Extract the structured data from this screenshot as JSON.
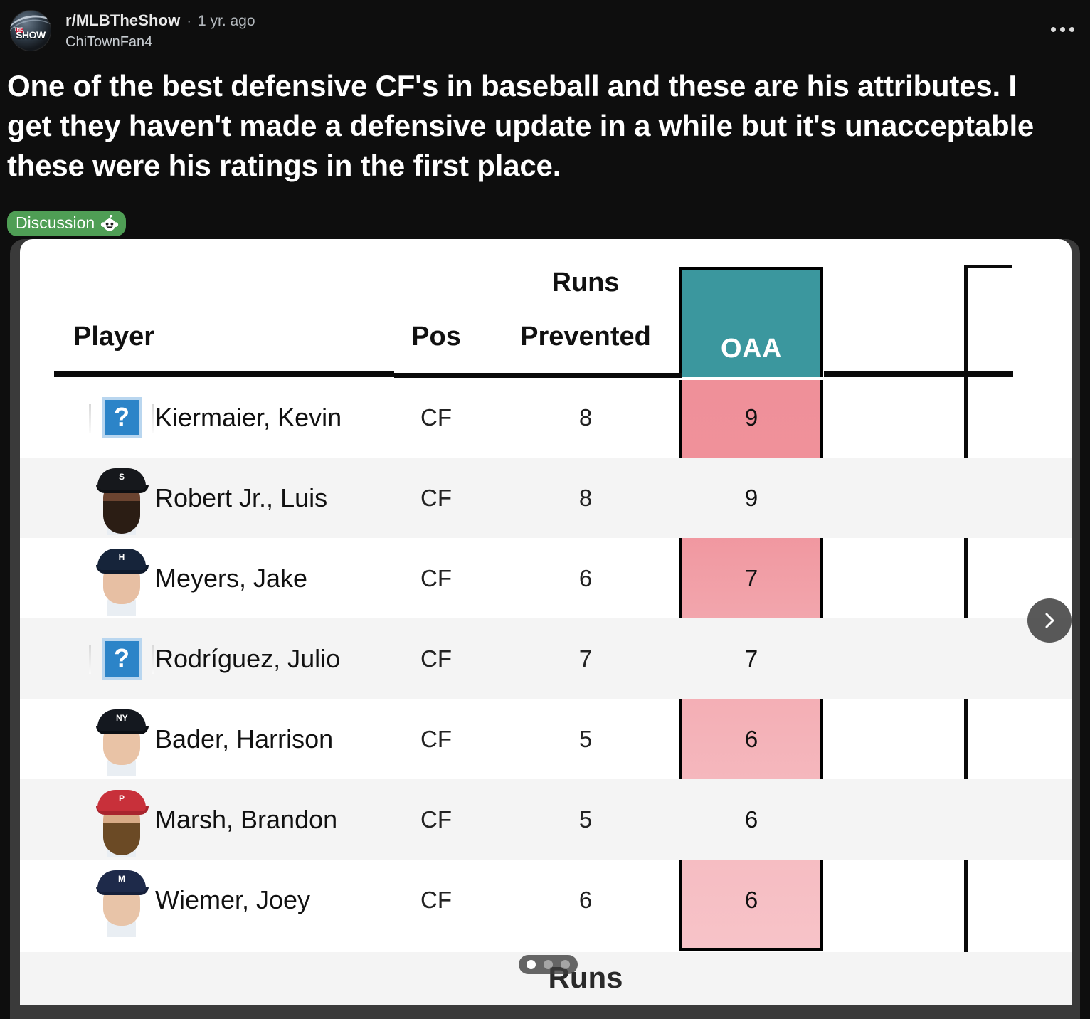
{
  "post": {
    "subreddit": "r/MLBTheShow",
    "separator": "·",
    "age": "1 yr. ago",
    "author": "ChiTownFan4",
    "avatar_logo_top": "THE",
    "avatar_logo": "SHOW",
    "title": "One of the best defensive CF's in baseball and these are his attributes. I get they haven't made a defensive update in a while but it's unacceptable these were his ratings in the first place.",
    "flair": "Discussion",
    "flair_icon": "reddit-snoo-icon",
    "flair_color": "#4f9e55",
    "overflow_icon": "overflow-menu-icon"
  },
  "carousel": {
    "next_icon": "chevron-right-icon",
    "dots": 3,
    "active_dot": 1
  },
  "table": {
    "headers": {
      "player": "Player",
      "pos": "Pos",
      "runs": "Runs",
      "prevented": "Prevented",
      "oaa": "OAA"
    },
    "footer_label": "Runs",
    "accent_teal": "#3b979e",
    "accent_pink": "#ef9099",
    "rows": [
      {
        "avatar": "broken-image-placeholder",
        "avatar_alt": "?",
        "name": "Kiermaier, Kevin",
        "pos": "CF",
        "runs_prevented": "8",
        "oaa": "9"
      },
      {
        "avatar": "headshot",
        "team": "CHW",
        "cap": "#16181c",
        "brim": "#0d0f12",
        "skin": "#6b4430",
        "beard": "#2b1d14",
        "logo": "S",
        "name": "Robert Jr., Luis",
        "pos": "CF",
        "runs_prevented": "8",
        "oaa": "9"
      },
      {
        "avatar": "headshot",
        "team": "HOU",
        "cap": "#16243a",
        "brim": "#0f1a2c",
        "skin": "#e7bfa3",
        "beard": "",
        "logo": "H",
        "name": "Meyers, Jake",
        "pos": "CF",
        "runs_prevented": "6",
        "oaa": "7"
      },
      {
        "avatar": "broken-image-placeholder",
        "avatar_alt": "?",
        "name": "Rodríguez, Julio",
        "pos": "CF",
        "runs_prevented": "7",
        "oaa": "7"
      },
      {
        "avatar": "headshot",
        "team": "NYY",
        "cap": "#14181f",
        "brim": "#0c0f14",
        "skin": "#e9c3a6",
        "beard": "",
        "logo": "NY",
        "name": "Bader, Harrison",
        "pos": "CF",
        "runs_prevented": "5",
        "oaa": "6"
      },
      {
        "avatar": "headshot",
        "team": "PHI",
        "cap": "#c8303a",
        "brim": "#a8252e",
        "skin": "#d8ab86",
        "beard": "#6b4a25",
        "logo": "P",
        "name": "Marsh, Brandon",
        "pos": "CF",
        "runs_prevented": "5",
        "oaa": "6"
      },
      {
        "avatar": "headshot",
        "team": "MIL",
        "cap": "#1e2a4a",
        "brim": "#16203a",
        "skin": "#e8c4a8",
        "beard": "",
        "logo": "M",
        "name": "Wiemer, Joey",
        "pos": "CF",
        "runs_prevented": "6",
        "oaa": "6"
      }
    ]
  },
  "chart_data": {
    "type": "table",
    "title": "Outs Above Average — Center Fielders",
    "columns": [
      "Player",
      "Pos",
      "Runs Prevented",
      "OAA"
    ],
    "rows": [
      [
        "Kiermaier, Kevin",
        "CF",
        8,
        9
      ],
      [
        "Robert Jr., Luis",
        "CF",
        8,
        9
      ],
      [
        "Meyers, Jake",
        "CF",
        6,
        7
      ],
      [
        "Rodríguez, Julio",
        "CF",
        7,
        7
      ],
      [
        "Bader, Harrison",
        "CF",
        5,
        6
      ],
      [
        "Marsh, Brandon",
        "CF",
        5,
        6
      ],
      [
        "Wiemer, Joey",
        "CF",
        6,
        6
      ]
    ],
    "highlighted_column": "OAA",
    "highlight_header_color": "#3b979e",
    "highlight_cell_color": "#ef9099"
  }
}
